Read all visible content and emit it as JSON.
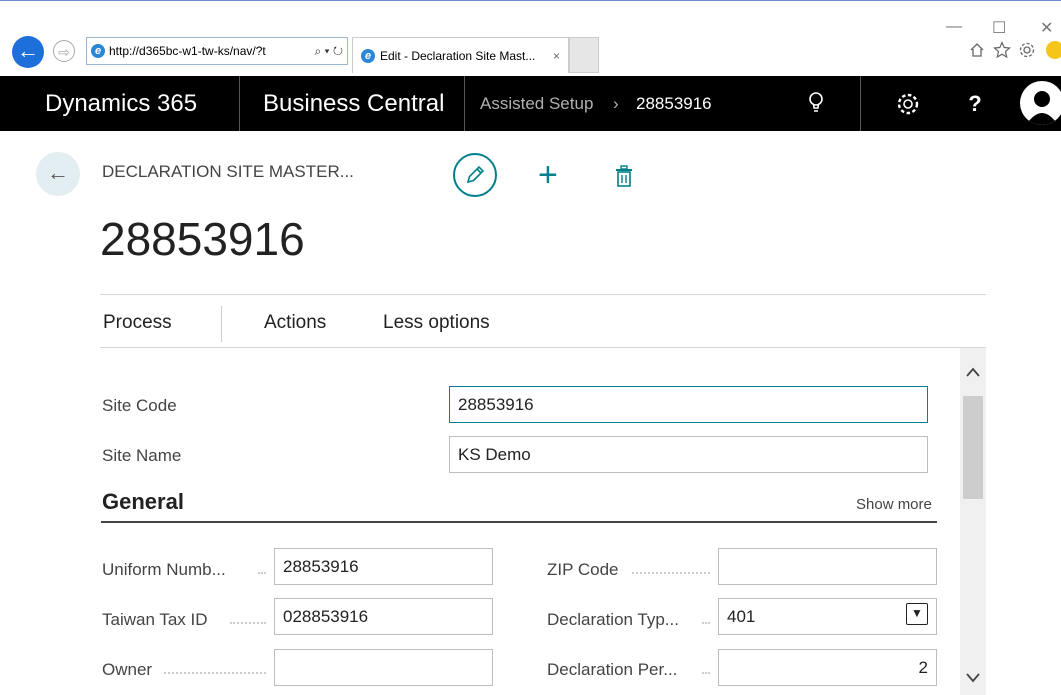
{
  "browser": {
    "url": "http://d365bc-w1-tw-ks/nav/?t",
    "tab_title": "Edit - Declaration Site Mast...",
    "tab_close": "×",
    "back_glyph": "←",
    "forward_glyph": "⇨",
    "addr_tools": "⌕ ▾ ↻",
    "ie_glyph": "e",
    "window_controls": [
      "—",
      "☐",
      "✕"
    ]
  },
  "appbar": {
    "product": "Dynamics 365",
    "app": "Business Central",
    "breadcrumb_parent": "Assisted Setup",
    "breadcrumb_sep": "›",
    "breadcrumb_current": "28853916",
    "help_glyph": "?",
    "colors": {
      "bar": "#000000",
      "accent": "#00808a"
    }
  },
  "page": {
    "caption": "DECLARATION SITE MASTER...",
    "record_title": "28853916",
    "back_glyph": "←",
    "add_glyph": "+"
  },
  "menu": {
    "process": "Process",
    "actions": "Actions",
    "less_options": "Less options"
  },
  "form": {
    "site_code": {
      "label": "Site Code",
      "value": "28853916"
    },
    "site_name": {
      "label": "Site Name",
      "value": "KS Demo"
    },
    "general": {
      "title": "General",
      "show_more": "Show more",
      "uniform_number": {
        "label": "Uniform Numb...",
        "value": "28853916"
      },
      "taiwan_tax_id": {
        "label": "Taiwan Tax ID",
        "value": "028853916"
      },
      "owner": {
        "label": "Owner",
        "value": ""
      },
      "zip_code": {
        "label": "ZIP Code",
        "value": ""
      },
      "declaration_type": {
        "label": "Declaration Typ...",
        "value": "401",
        "dropdown_glyph": "▼"
      },
      "declaration_period": {
        "label": "Declaration Per...",
        "value": "2"
      }
    }
  },
  "scroll": {
    "up_glyph": "⌃",
    "down_glyph": "⌄"
  }
}
